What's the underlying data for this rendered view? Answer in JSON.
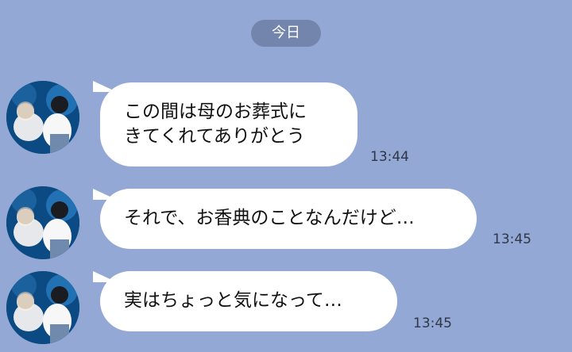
{
  "date_separator": "今日",
  "messages": [
    {
      "lines": [
        "この間は母のお葬式に",
        "きてくれてありがとう"
      ],
      "time": "13:44"
    },
    {
      "lines": [
        "それで、お香典のことなんだけど…"
      ],
      "time": "13:45"
    },
    {
      "lines": [
        "実はちょっと気になって…"
      ],
      "time": "13:45"
    }
  ],
  "colors": {
    "background": "#93a8d4",
    "date_pill": "#7385ac",
    "bubble": "#ffffff",
    "time_text": "#2f3748"
  }
}
